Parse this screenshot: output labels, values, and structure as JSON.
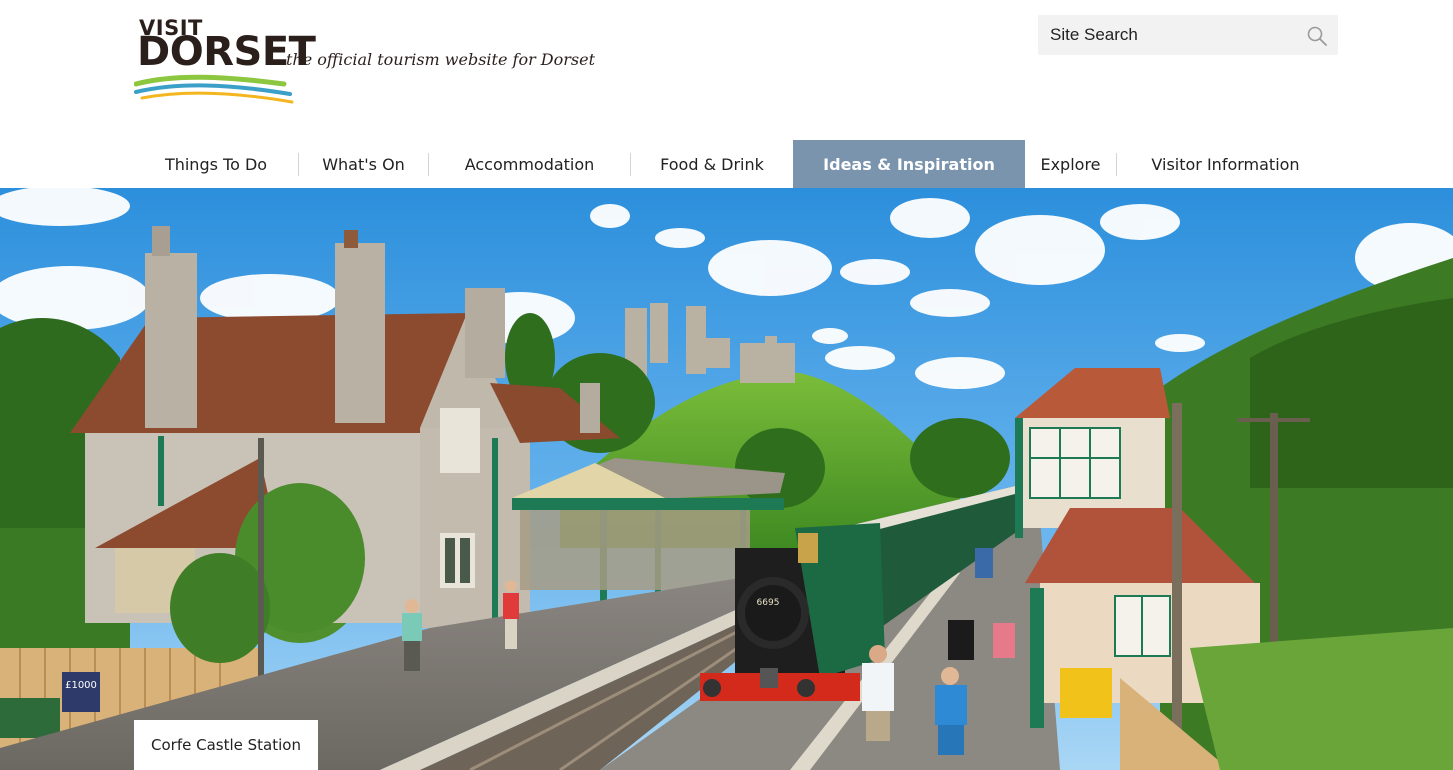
{
  "brand": {
    "visit": "VISIT",
    "dorset": "DORSET",
    "tagline": "the official tourism website for Dorset",
    "colors": {
      "text": "#2b1f1c",
      "green": "#8dc63f",
      "blue": "#3aa0c8",
      "yellow": "#f3b61f"
    }
  },
  "search": {
    "placeholder": "Site Search",
    "icon": "magnifier-icon"
  },
  "nav": {
    "items": [
      {
        "label": "Things To Do"
      },
      {
        "label": "What's On"
      },
      {
        "label": "Accommodation"
      },
      {
        "label": "Food & Drink"
      },
      {
        "label": "Ideas & Inspiration",
        "active": true
      },
      {
        "label": "Explore"
      },
      {
        "label": "Visitor Information"
      }
    ],
    "active_color": "#7b94ad"
  },
  "hero": {
    "caption": "Corfe Castle Station",
    "locomotive_number": "6695",
    "sign_text": "£1000"
  }
}
